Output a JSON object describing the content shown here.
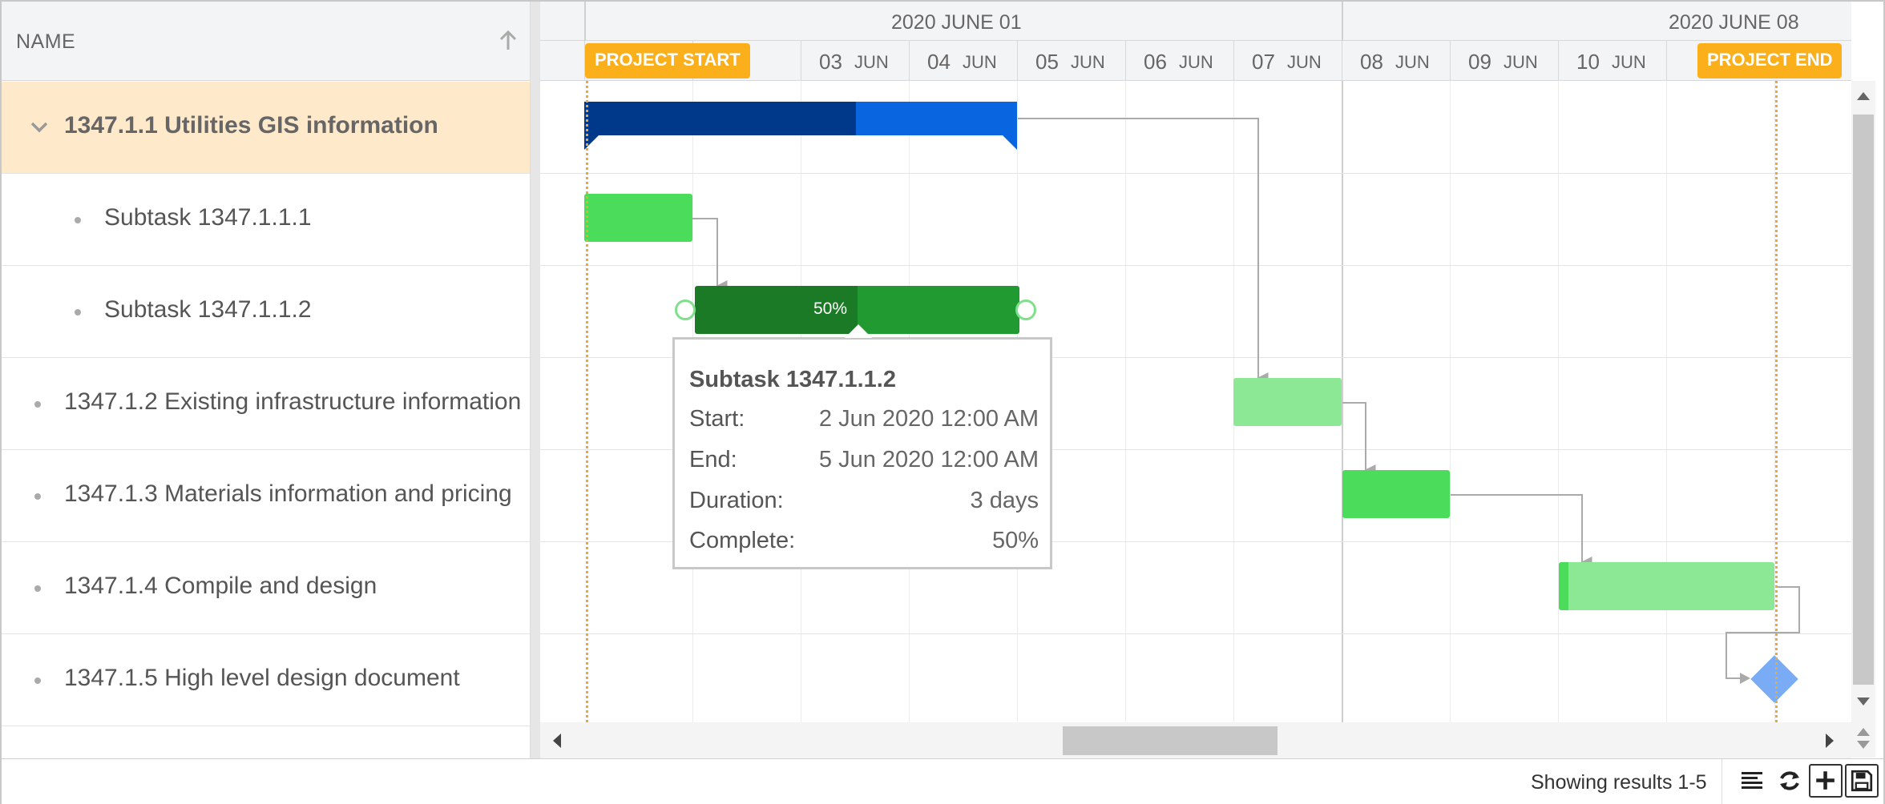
{
  "tree": {
    "header_label": "NAME",
    "rows": [
      {
        "label": "1347.1.1 Utilities GIS information"
      },
      {
        "label": "Subtask 1347.1.1.1"
      },
      {
        "label": "Subtask 1347.1.1.2"
      },
      {
        "label": "1347.1.2 Existing infrastructure information"
      },
      {
        "label": "1347.1.3 Materials information and pricing"
      },
      {
        "label": "1347.1.4 Compile and design"
      },
      {
        "label": "1347.1.5 High level design document"
      }
    ]
  },
  "timeline": {
    "weeks": [
      "2020 JUNE 01",
      "2020 JUNE 08"
    ],
    "days": [
      {
        "num": "03",
        "mon": "JUN"
      },
      {
        "num": "04",
        "mon": "JUN"
      },
      {
        "num": "05",
        "mon": "JUN"
      },
      {
        "num": "06",
        "mon": "JUN"
      },
      {
        "num": "07",
        "mon": "JUN"
      },
      {
        "num": "08",
        "mon": "JUN"
      },
      {
        "num": "09",
        "mon": "JUN"
      },
      {
        "num": "10",
        "mon": "JUN"
      }
    ]
  },
  "markers": {
    "start": "PROJECT START",
    "end": "PROJECT END"
  },
  "bars": {
    "subtask_2_percent": "50%"
  },
  "tooltip": {
    "title": "Subtask 1347.1.1.2",
    "start_label": "Start:",
    "start_value": "2 Jun 2020 12:00 AM",
    "end_label": "End:",
    "end_value": "5 Jun 2020 12:00 AM",
    "duration_label": "Duration:",
    "duration_value": "3 days",
    "complete_label": "Complete:",
    "complete_value": "50%"
  },
  "footer": {
    "status": "Showing results 1-5"
  },
  "colors": {
    "summary_done": "#00388a",
    "summary_rest": "#0a66e0",
    "task_green": "#4cdc5c",
    "task_light": "#8ce894",
    "task_dark": "#1a7a25",
    "marker": "#fbb01b",
    "selected_row": "#ffe9cb",
    "milestone": "#7aabf5"
  }
}
